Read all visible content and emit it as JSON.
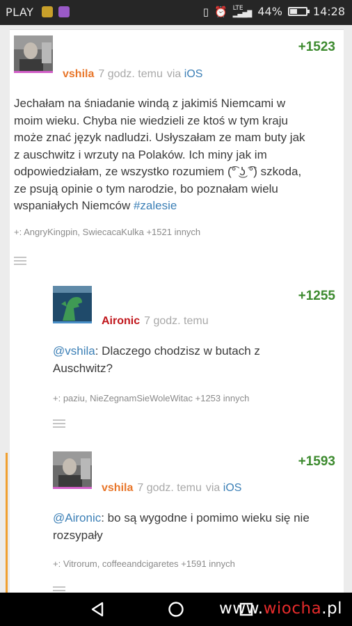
{
  "status_bar": {
    "carrier": "PLAY",
    "network": "LTE",
    "battery": "44%",
    "battery_level": 0.44,
    "time": "14:28"
  },
  "entries": [
    {
      "votes": "+1523",
      "author": "vshila",
      "time": "7 godz. temu",
      "via_prefix": "via",
      "via_platform": "iOS",
      "body": [
        "Jechałam na śniadanie windą z jakimiś Niemcami w",
        "moim wieku. Chyba nie wiedzieli ze ktoś w tym kraju",
        "może znać język nadludzi. Usłyszałam ze mam buty jak",
        "z auschwitz i wrzuty na Polaków. Ich miny jak im",
        "odpowiedziałam, ze wszystko rozumiem (͡° ͜ʖ ͡°) szkoda,",
        "ze psują opinie o tym narodzie, bo poznałam wielu"
      ],
      "body_last_prefix": "wspaniałych Niemców ",
      "body_last_tag": "#zalesie",
      "voters_prefix": "+: ",
      "voters_names": "AngryKingpin, SwiecacaKulka",
      "voters_more": "+1521 innych"
    },
    {
      "votes": "+1255",
      "author": "Aironic",
      "time": "7 godz. temu",
      "mention": "@vshila",
      "body_line1": ": Dlaczego chodzisz w butach z",
      "body_line2": "Auschwitz?",
      "voters_prefix": "+: ",
      "voters_names": "paziu, NieZegnamSieWoleWitac",
      "voters_more": "+1253 innych"
    },
    {
      "votes": "+1593",
      "author": "vshila",
      "time": "7 godz. temu",
      "via_prefix": "via",
      "via_platform": "iOS",
      "mention": "@Aironic",
      "body_line1": ": bo są wygodne i pomimo wieku się nie",
      "body_line2": "rozsypały",
      "voters_prefix": "+: ",
      "voters_names": "Vitrorum, coffeeandcigaretes",
      "voters_more": "+1591 innych"
    }
  ],
  "nav": {
    "watermark_a": "www.",
    "watermark_b": "wiocha",
    "watermark_c": ".pl"
  },
  "colors": {
    "vote_green": "#3c8a2e",
    "author_orange": "#e8762a",
    "author_red": "#c0151b",
    "link_blue": "#3b7fb6",
    "female_underline": "#d25fc8",
    "male_underline": "#4a90c8",
    "reply_bar": "#f0a030"
  }
}
